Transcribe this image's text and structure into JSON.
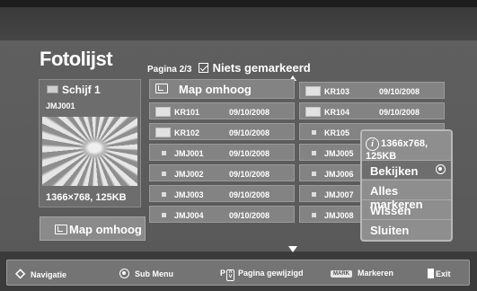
{
  "app": {
    "title": "Fotolijst"
  },
  "status": {
    "page_label": "Pagina 2/3",
    "marked_label": "Niets gemarkeerd"
  },
  "left": {
    "drive_label": "Schijf 1",
    "folder_label": "JMJ001",
    "resolution": "1366×768, 125KB",
    "up_button_label": "Map omhoog"
  },
  "grid": {
    "up_label": "Map omhoog",
    "col1": [
      {
        "name": "KR101",
        "date": "09/10/2008",
        "kind": "folder"
      },
      {
        "name": "KR102",
        "date": "09/10/2008",
        "kind": "folder"
      },
      {
        "name": "JMJ001",
        "date": "09/10/2008",
        "kind": "file"
      },
      {
        "name": "JMJ002",
        "date": "09/10/2008",
        "kind": "file"
      },
      {
        "name": "JMJ003",
        "date": "09/10/2008",
        "kind": "file"
      },
      {
        "name": "JMJ004",
        "date": "09/10/2008",
        "kind": "file"
      }
    ],
    "col2": [
      {
        "name": "KR103",
        "date": "09/10/2008",
        "kind": "folder"
      },
      {
        "name": "KR104",
        "date": "09/10/2008",
        "kind": "folder"
      },
      {
        "name": "KR105",
        "date": "",
        "kind": "file"
      },
      {
        "name": "JMJ005",
        "date": "",
        "kind": "file"
      },
      {
        "name": "JMJ006",
        "date": "",
        "kind": "file"
      },
      {
        "name": "JMJ007",
        "date": "",
        "kind": "file"
      },
      {
        "name": "JMJ008",
        "date": "",
        "kind": "file"
      }
    ]
  },
  "popup": {
    "resolution": "1366x768, 125KB",
    "items": [
      "Bekijken",
      "Alles markeren",
      "Wissen",
      "Sluiten"
    ],
    "selected_index": 0
  },
  "bottom": {
    "nav": "Navigatie",
    "submenu": "Sub Menu",
    "page_change": "Pagina gewijzigd",
    "mark_key": "MARK",
    "mark": "Markeren",
    "exit": "Exit"
  }
}
